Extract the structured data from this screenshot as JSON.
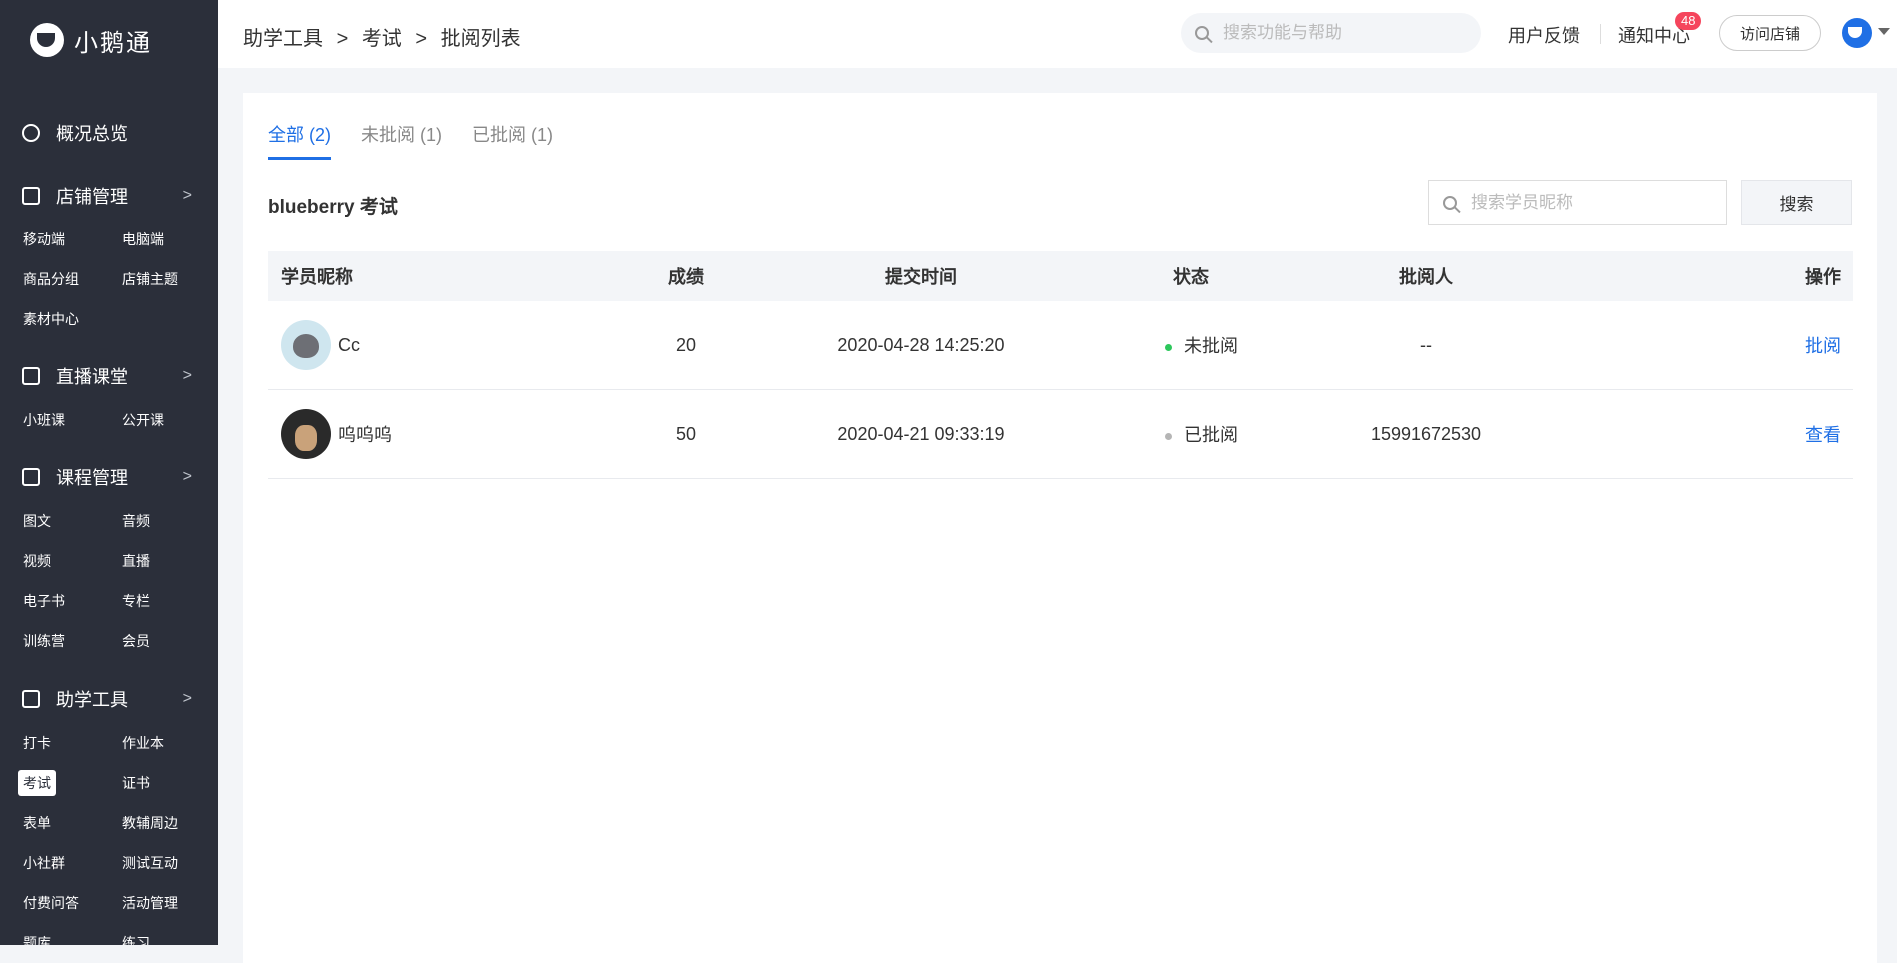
{
  "brand": {
    "name": "小鹅通"
  },
  "sidebar": {
    "overview": "概况总览",
    "store": {
      "label": "店铺管理",
      "items": [
        "移动端",
        "电脑端",
        "商品分组",
        "店铺主题",
        "素材中心"
      ]
    },
    "live": {
      "label": "直播课堂",
      "items": [
        "小班课",
        "公开课"
      ]
    },
    "course": {
      "label": "课程管理",
      "items": [
        "图文",
        "音频",
        "视频",
        "直播",
        "电子书",
        "专栏",
        "训练营",
        "会员"
      ]
    },
    "tools": {
      "label": "助学工具",
      "items": [
        "打卡",
        "作业本",
        "考试",
        "证书",
        "表单",
        "教辅周边",
        "小社群",
        "测试互动",
        "付费问答",
        "活动管理",
        "题库",
        "练习"
      ]
    }
  },
  "header": {
    "breadcrumb": [
      "助学工具",
      ">",
      "考试",
      ">",
      "批阅列表"
    ],
    "search_placeholder": "搜索功能与帮助",
    "feedback": "用户反馈",
    "notify": "通知中心",
    "notify_count": "48",
    "visit_store": "访问店铺"
  },
  "main": {
    "tabs": [
      "全部 (2)",
      "未批阅 (1)",
      "已批阅 (1)"
    ],
    "exam_title": "blueberry 考试",
    "search_placeholder": "搜索学员昵称",
    "search_button": "搜索",
    "columns": [
      "学员昵称",
      "成绩",
      "提交时间",
      "状态",
      "批阅人",
      "操作"
    ],
    "rows": [
      {
        "name": "Cc",
        "score": "20",
        "time": "2020-04-28 14:25:20",
        "status": "未批阅",
        "status_color": "#2dc75c",
        "reviewer": "--",
        "action": "批阅"
      },
      {
        "name": "呜呜呜",
        "score": "50",
        "time": "2020-04-21 09:33:19",
        "status": "已批阅",
        "status_color": "#b5b5b5",
        "reviewer": "15991672530",
        "action": "查看"
      }
    ]
  },
  "colors": {
    "sidebar_bg": "#2b2f3a",
    "accent": "#1f6fe5",
    "badge": "#f5455c"
  }
}
